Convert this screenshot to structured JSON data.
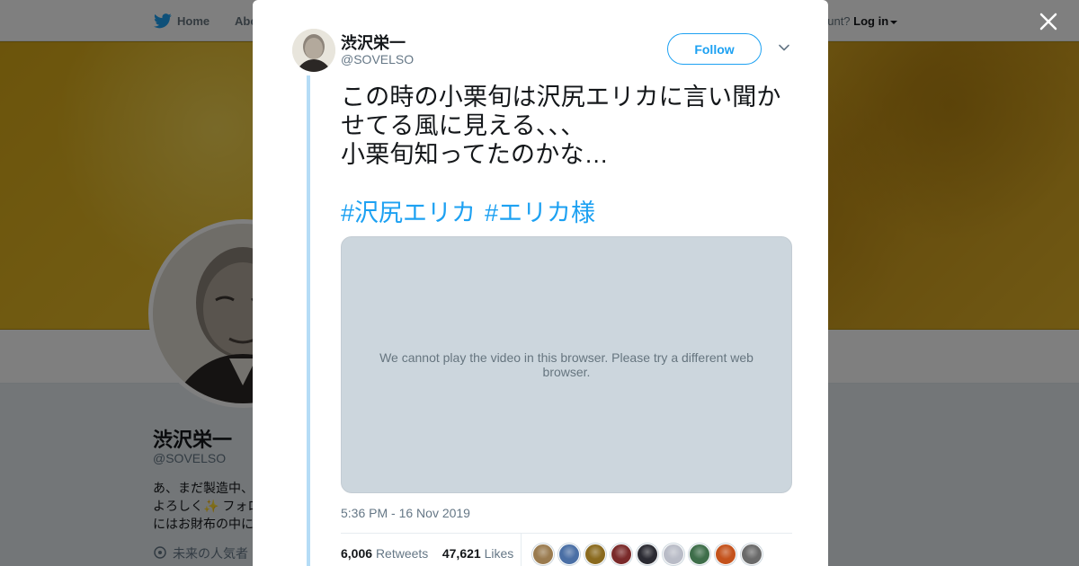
{
  "topbar": {
    "home_label": "Home",
    "about_label": "Abo",
    "account_prompt": "ccount?",
    "login_label": "Log in"
  },
  "profile": {
    "name": "渋沢栄一",
    "handle": "@SOVELSO",
    "bio_lines": [
      "あ、まだ製造中、",
      "よろしく✨ フォロ",
      "にはお財布の中に"
    ],
    "location": "未来の人気者"
  },
  "tweet": {
    "author_name": "渋沢栄一",
    "author_handle": "@SOVELSO",
    "follow_label": "Follow",
    "text_lines": [
      "この時の小栗旬は沢尻エリカに言い聞か",
      "せてる風に見える、、、",
      "小栗旬知ってたのかな…"
    ],
    "hashtags": [
      "#沢尻エリカ",
      "#エリカ様"
    ],
    "video_message": "We cannot play the video in this browser. Please try a different web browser.",
    "timestamp": "5:36 PM - 16 Nov 2019",
    "retweets_count": "6,006",
    "retweets_label": "Retweets",
    "likes_count": "47,621",
    "likes_label": "Likes",
    "liker_avatar_colors": [
      "#9a7b4f",
      "#4a6fa5",
      "#8a6a1e",
      "#7a2a2a",
      "#2b2b33",
      "#b9bcc7",
      "#3e6e4a",
      "#c4521c",
      "#6a6a6a"
    ]
  },
  "colors": {
    "brand_blue": "#1da1f2",
    "thread_line": "#b5dcf6",
    "banner_gold": "#dcae22"
  },
  "icons": {
    "close": "close-icon",
    "chevron": "chevron-down-icon",
    "bird": "twitter-bird-icon",
    "location": "location-pin-icon"
  }
}
